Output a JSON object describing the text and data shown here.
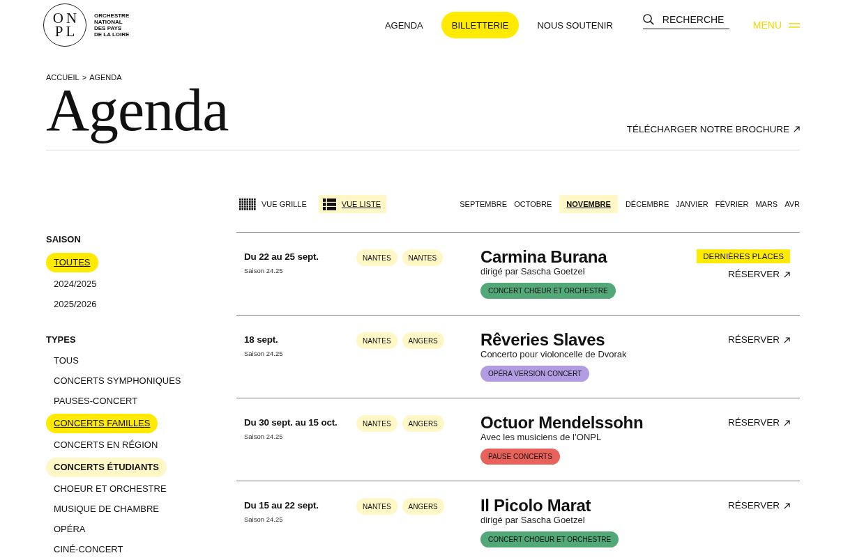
{
  "header": {
    "logo": {
      "monogram": [
        "ON",
        "PL"
      ],
      "name": [
        "ORCHESTRE",
        "NATIONAL",
        "DES PAYS",
        "DE LA LOIRE"
      ]
    },
    "nav": [
      {
        "label": "AGENDA",
        "kind": "link"
      },
      {
        "label": "BILLETTERIE",
        "kind": "cta"
      },
      {
        "label": "NOUS SOUTENIR",
        "kind": "link"
      }
    ],
    "search": {
      "placeholder": "RECHERCHE"
    },
    "menu": {
      "label": "MENU"
    }
  },
  "breadcrumb": {
    "items": [
      "ACCUEIL",
      "AGENDA"
    ],
    "separator": ">"
  },
  "page_title": "Agenda",
  "brochure_link": "TÉLÉCHARGER NOTRE BROCHURE",
  "view_toggles": [
    {
      "label": "VUE GRILLE",
      "kind": "grid",
      "selected": false
    },
    {
      "label": "VUE LISTE",
      "kind": "list",
      "selected": true
    }
  ],
  "months": [
    {
      "label": "SEPTEMBRE",
      "selected": false
    },
    {
      "label": "OCTOBRE",
      "selected": false
    },
    {
      "label": "NOVEMBRE",
      "selected": true
    },
    {
      "label": "DÉCEMBRE",
      "selected": false
    },
    {
      "label": "JANVIER",
      "selected": false
    },
    {
      "label": "FÉVRIER",
      "selected": false
    },
    {
      "label": "MARS",
      "selected": false
    },
    {
      "label": "AVR",
      "selected": false
    }
  ],
  "filters": [
    {
      "title": "SAISON",
      "items": [
        {
          "label": "TOUTES",
          "selected": true,
          "hovered": false
        },
        {
          "label": "2024/2025",
          "selected": false,
          "hovered": false
        },
        {
          "label": "2025/2026",
          "selected": false,
          "hovered": false
        }
      ]
    },
    {
      "title": "TYPES",
      "items": [
        {
          "label": "TOUS",
          "selected": false,
          "hovered": false
        },
        {
          "label": "CONCERTS SYMPHONIQUES",
          "selected": false,
          "hovered": false
        },
        {
          "label": "PAUSES-CONCERT",
          "selected": false,
          "hovered": false
        },
        {
          "label": "CONCERTS FAMILLES",
          "selected": true,
          "hovered": false
        },
        {
          "label": "CONCERTS EN RÉGION",
          "selected": false,
          "hovered": false
        },
        {
          "label": "CONCERTS ÉTUDIANTS",
          "selected": false,
          "hovered": true
        },
        {
          "label": "CHOEUR ET ORCHESTRE",
          "selected": false,
          "hovered": false
        },
        {
          "label": "MUSIQUE DE CHAMBRE",
          "selected": false,
          "hovered": false
        },
        {
          "label": "OPÉRA",
          "selected": false,
          "hovered": false
        },
        {
          "label": "CINÉ-CONCERT",
          "selected": false,
          "hovered": false
        }
      ]
    }
  ],
  "events": [
    {
      "date": "Du 22 au 25 sept.",
      "season": "Saison 24.25",
      "venues": [
        "NANTES",
        "NANTES"
      ],
      "title": "Carmina Burana",
      "subtitle": "dirigé par Sascha Goetzel",
      "category": {
        "label": "CONCERT CHŒUR ET ORCHESTRE",
        "color": "#52a877"
      },
      "badge": "DERNIÈRES PLACES",
      "action": "RÉSERVER"
    },
    {
      "date": "18 sept.",
      "season": "Saison 24.25",
      "venues": [
        "NANTES",
        "ANGERS"
      ],
      "title": "Rêveries Slaves",
      "subtitle": "Concerto pour violoncelle de Dvorak",
      "category": {
        "label": "OPÉRA VERSION CONCERT",
        "color": "#b29ce4"
      },
      "action": "RÉSERVER"
    },
    {
      "date": "Du 30 sept. au 15 oct.",
      "season": "Saison 24.25",
      "venues": [
        "NANTES",
        "ANGERS"
      ],
      "title": "Octuor Mendelssohn",
      "subtitle": "Avec les musiciens de l’ONPL",
      "category": {
        "label": "PAUSE CONCERTS",
        "color": "#e8625b"
      },
      "action": "RÉSERVER"
    },
    {
      "date": "Du 15 au 22 sept.",
      "season": "Saison 24.25",
      "venues": [
        "NANTES",
        "ANGERS"
      ],
      "title": "Il Picolo Marat",
      "subtitle": "dirigé par Sascha Goetzel",
      "category": {
        "label": "CONCERT CHOEUR ET ORCHESTRE",
        "color": "#52a877"
      },
      "action": "RÉSERVER"
    }
  ]
}
